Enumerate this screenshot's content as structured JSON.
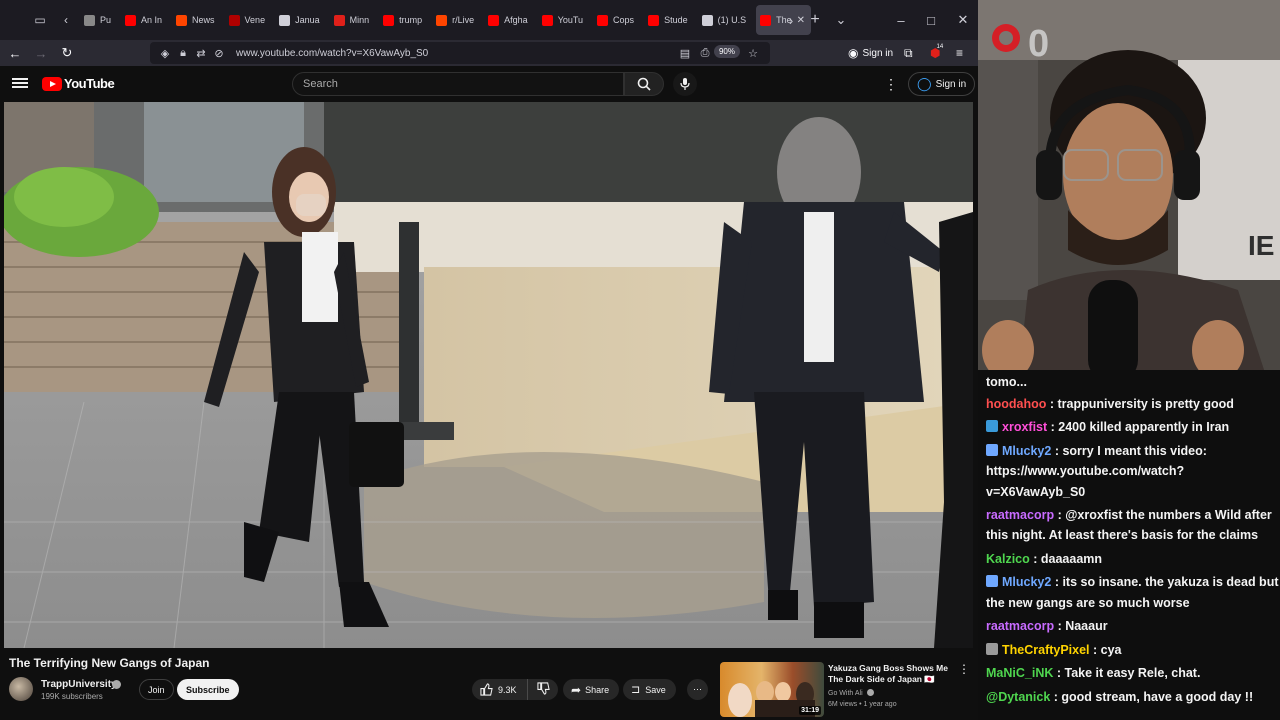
{
  "browser": {
    "tabs": [
      {
        "label": "Pu",
        "color": "#888888"
      },
      {
        "label": "An In",
        "color": "#ff0000"
      },
      {
        "label": "News",
        "color": "#ff4500"
      },
      {
        "label": "Vene",
        "color": "#b00000"
      },
      {
        "label": "Janua",
        "color": "#cfcfd8"
      },
      {
        "label": "Minn",
        "color": "#e0201a"
      },
      {
        "label": "trump",
        "color": "#ff0000"
      },
      {
        "label": "r/Live",
        "color": "#ff4500"
      },
      {
        "label": "Afgha",
        "color": "#ff0000"
      },
      {
        "label": "YouTu",
        "color": "#ff0000"
      },
      {
        "label": "Cops",
        "color": "#ff0000"
      },
      {
        "label": "Stude",
        "color": "#ff0000"
      },
      {
        "label": "(1) U.S",
        "color": "#cfcfd8"
      },
      {
        "label": "The",
        "color": "#ff0000"
      }
    ],
    "url": "www.youtube.com/watch?v=X6VawAyb_S0",
    "zoom": "90%",
    "sign_in": "Sign in",
    "extension_badge": "14"
  },
  "youtube": {
    "logo_text": "YouTube",
    "search_placeholder": "Search",
    "sign_in": "Sign in",
    "video": {
      "title": "The Terrifying New Gangs of Japan",
      "channel": "TrappUniversity",
      "subscribers": "199K subscribers",
      "join": "Join",
      "subscribe": "Subscribe",
      "likes": "9.3K",
      "share": "Share",
      "save": "Save"
    },
    "recommended": {
      "title": "Yakuza Gang Boss Shows Me The Dark Side of Japan 🇯🇵",
      "channel": "Go With Ali",
      "meta": "6M views • 1 year ago",
      "duration": "31:19"
    }
  },
  "chat": {
    "messages": [
      {
        "user": "tomo...",
        "user_color": "#f4f4f4",
        "text": "",
        "badge": ""
      },
      {
        "user": "hoodahoo",
        "user_color": "#ff4f4f",
        "text": " : trappuniversity is pretty good",
        "badge": ""
      },
      {
        "user": "xroxfist",
        "user_color": "#ff4fd8",
        "text": " : 2400 killed apparently in Iran",
        "badge": "#3a9ad9"
      },
      {
        "user": "Mlucky2",
        "user_color": "#6fa8ff",
        "text": " : sorry I meant this video:",
        "badge": "#6fa8ff"
      },
      {
        "user": "",
        "user_color": "#f4f4f4",
        "text": "https://www.youtube.com/watch?",
        "badge": ""
      },
      {
        "user": "",
        "user_color": "#f4f4f4",
        "text": "v=X6VawAyb_S0",
        "badge": ""
      },
      {
        "user": "raatmacorp",
        "user_color": "#c86bff",
        "text": " : @xroxfist the numbers a Wild after",
        "badge": ""
      },
      {
        "user": "",
        "user_color": "#f4f4f4",
        "text": "this night. At least there's basis for the claims",
        "badge": ""
      },
      {
        "user": "Kalzico",
        "user_color": "#4fd64f",
        "text": " : daaaaamn",
        "badge": ""
      },
      {
        "user": "Mlucky2",
        "user_color": "#6fa8ff",
        "text": " : its so insane. the yakuza is dead but",
        "badge": "#6fa8ff"
      },
      {
        "user": "",
        "user_color": "#f4f4f4",
        "text": "the new gangs are so much worse",
        "badge": ""
      },
      {
        "user": "raatmacorp",
        "user_color": "#c86bff",
        "text": " : Naaaur",
        "badge": ""
      },
      {
        "user": "TheCraftyPixel",
        "user_color": "#ffd400",
        "text": " : cya",
        "badge": "#9a9a9a"
      },
      {
        "user": "MaNiC_iNK",
        "user_color": "#4fd64f",
        "text": " : Take it easy Rele, chat.",
        "badge": ""
      },
      {
        "user": "@Dytanick",
        "user_color": "#4fd64f",
        "text": " : good stream, have a good day !!",
        "badge": ""
      }
    ]
  }
}
